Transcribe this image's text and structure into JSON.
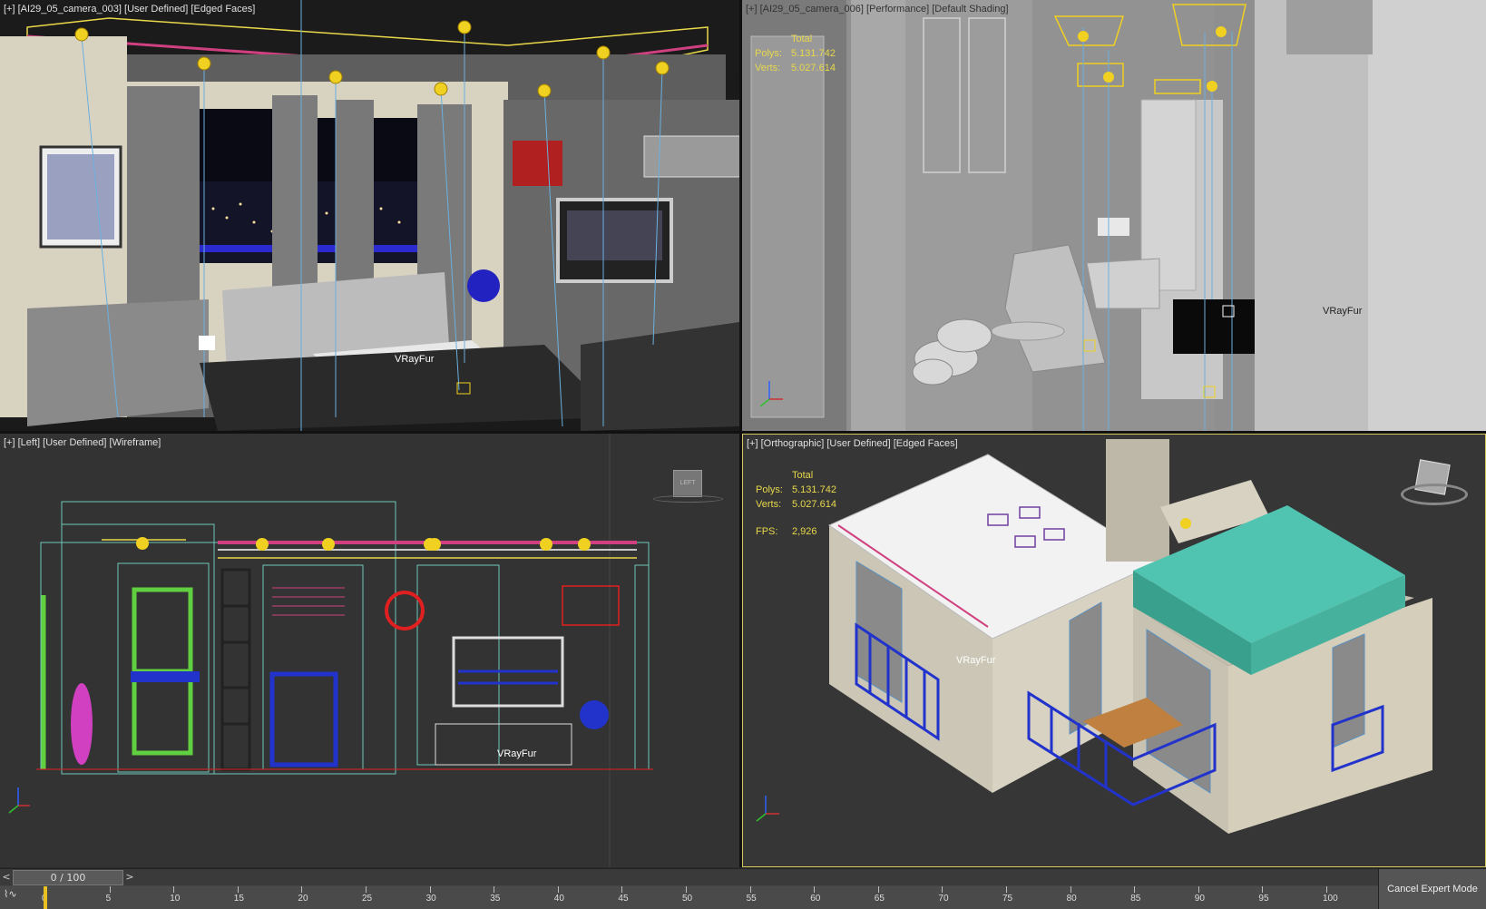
{
  "viewports": {
    "top_left": {
      "label_parts": [
        "[+]",
        "[AI29_05_camera_003]",
        "[User Defined]",
        "[Edged Faces]"
      ],
      "vrayfur": "VRayFur"
    },
    "top_right": {
      "label_parts": [
        "[+]",
        "[AI29_05_camera_006]",
        "[Performance]",
        "[Default Shading]"
      ],
      "stats": {
        "total_label": "Total",
        "polys_label": "Polys:",
        "polys": "5.131.742",
        "verts_label": "Verts:",
        "verts": "5.027.614"
      },
      "vrayfur": "VRayFur"
    },
    "bottom_left": {
      "label_parts": [
        "[+]",
        "[Left]",
        "[User Defined]",
        "[Wireframe]"
      ],
      "viewcube_label": "LEFT",
      "vrayfur": "VRayFur"
    },
    "bottom_right": {
      "label_parts": [
        "[+]",
        "[Orthographic]",
        "[User Defined]",
        "[Edged Faces]"
      ],
      "stats": {
        "total_label": "Total",
        "polys_label": "Polys:",
        "polys": "5.131.742",
        "verts_label": "Verts:",
        "verts": "5.027.614",
        "fps_label": "FPS:",
        "fps": "2,926"
      },
      "vrayfur": "VRayFur"
    }
  },
  "timeline": {
    "prev": "<",
    "next": ">",
    "frame_display": "0 / 100",
    "ticks": [
      "0",
      "5",
      "10",
      "15",
      "20",
      "25",
      "30",
      "35",
      "40",
      "45",
      "50",
      "55",
      "60",
      "65",
      "70",
      "75",
      "80",
      "85",
      "90",
      "95",
      "100"
    ],
    "cancel_expert_mode": "Cancel Expert Mode"
  },
  "colors": {
    "active_viewport_border": "#d8c860",
    "stats_text": "#e8d84a",
    "light_gizmo": "#f0d020"
  }
}
